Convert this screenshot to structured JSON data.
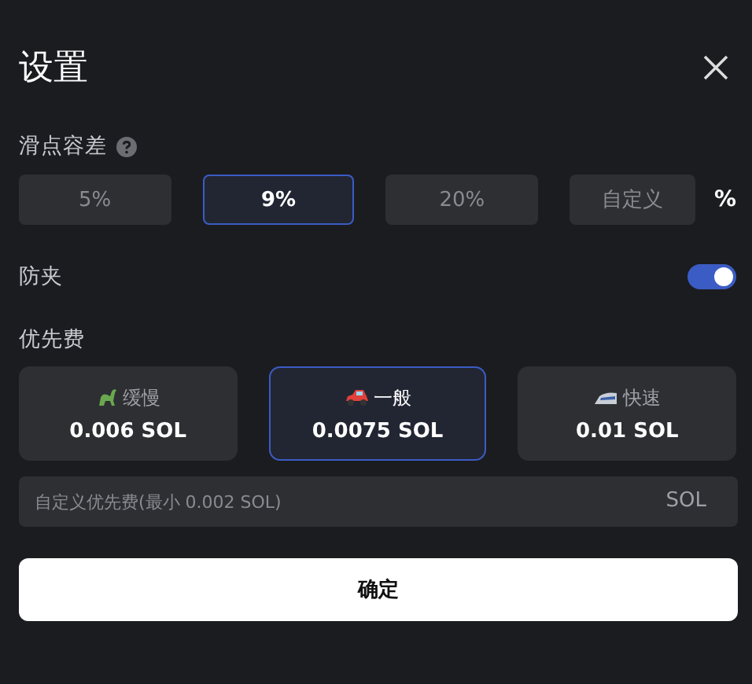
{
  "window": {
    "title": "设置"
  },
  "slippage": {
    "label": "滑点容差",
    "options": [
      {
        "label": "5%",
        "selected": false
      },
      {
        "label": "9%",
        "selected": true
      },
      {
        "label": "20%",
        "selected": false
      }
    ],
    "custom": {
      "placeholder": "自定义"
    },
    "unit": "%"
  },
  "anti_mev": {
    "label": "防夹",
    "on": true
  },
  "priority_fee": {
    "label": "优先费",
    "options": [
      {
        "kind": "slow",
        "label": "缓慢",
        "value": "0.006 SOL",
        "selected": false
      },
      {
        "kind": "normal",
        "label": "一般",
        "value": "0.0075 SOL",
        "selected": true
      },
      {
        "kind": "fast",
        "label": "快速",
        "value": "0.01 SOL",
        "selected": false
      }
    ],
    "custom": {
      "placeholder": "自定义优先费(最小 0.002 SOL)",
      "unit": "SOL"
    }
  },
  "confirm_button": "确定"
}
